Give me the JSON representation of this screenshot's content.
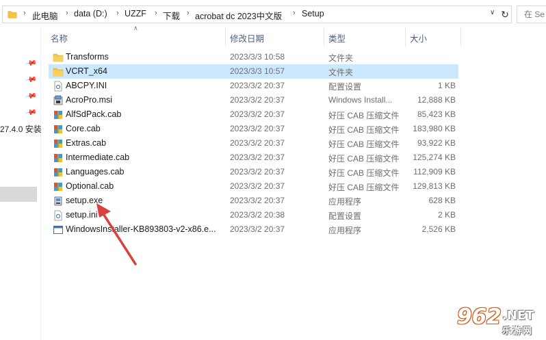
{
  "address": {
    "crumbs": [
      "此电脑",
      "data (D:)",
      "UZZF",
      "下载",
      "acrobat dc 2023中文版",
      "Setup"
    ],
    "search_placeholder": "在 Se"
  },
  "sidebar": {
    "partial_text": "27.4.0 安装"
  },
  "columns": {
    "name": "名称",
    "date": "修改日期",
    "type": "类型",
    "size": "大小"
  },
  "files": [
    {
      "name": "Transforms",
      "date": "2023/3/3 10:58",
      "type": "文件夹",
      "size": "",
      "icon": "folder-icon"
    },
    {
      "name": "VCRT_x64",
      "date": "2023/3/3 10:57",
      "type": "文件夹",
      "size": "",
      "icon": "folder-icon"
    },
    {
      "name": "ABCPY.INI",
      "date": "2023/3/2 20:37",
      "type": "配置设置",
      "size": "1 KB",
      "icon": "settings-file-icon"
    },
    {
      "name": "AcroPro.msi",
      "date": "2023/3/2 20:37",
      "type": "Windows Install...",
      "size": "12,888 KB",
      "icon": "msi-installer-icon"
    },
    {
      "name": "AlfSdPack.cab",
      "date": "2023/3/2 20:37",
      "type": "好压 CAB 压缩文件",
      "size": "85,423 KB",
      "icon": "archive-icon"
    },
    {
      "name": "Core.cab",
      "date": "2023/3/2 20:37",
      "type": "好压 CAB 压缩文件",
      "size": "183,980 KB",
      "icon": "archive-icon"
    },
    {
      "name": "Extras.cab",
      "date": "2023/3/2 20:37",
      "type": "好压 CAB 压缩文件",
      "size": "93,922 KB",
      "icon": "archive-icon"
    },
    {
      "name": "Intermediate.cab",
      "date": "2023/3/2 20:37",
      "type": "好压 CAB 压缩文件",
      "size": "125,274 KB",
      "icon": "archive-icon"
    },
    {
      "name": "Languages.cab",
      "date": "2023/3/2 20:37",
      "type": "好压 CAB 压缩文件",
      "size": "112,909 KB",
      "icon": "archive-icon"
    },
    {
      "name": "Optional.cab",
      "date": "2023/3/2 20:37",
      "type": "好压 CAB 压缩文件",
      "size": "129,813 KB",
      "icon": "archive-icon"
    },
    {
      "name": "setup.exe",
      "date": "2023/3/2 20:37",
      "type": "应用程序",
      "size": "628 KB",
      "icon": "setup-exe-icon"
    },
    {
      "name": "setup.ini",
      "date": "2023/3/2 20:38",
      "type": "配置设置",
      "size": "2 KB",
      "icon": "settings-file-icon"
    },
    {
      "name": "WindowsInstaller-KB893803-v2-x86.e...",
      "date": "2023/3/2 20:37",
      "type": "应用程序",
      "size": "2,526 KB",
      "icon": "exe-window-icon"
    }
  ],
  "watermark": {
    "number": "962",
    "net": ".NET",
    "sub": "乐游网"
  },
  "colors": {
    "selected_row": "#cce8ff",
    "header_text": "#4d6082",
    "folder": "#f5c242",
    "arrow": "#d9413a"
  }
}
